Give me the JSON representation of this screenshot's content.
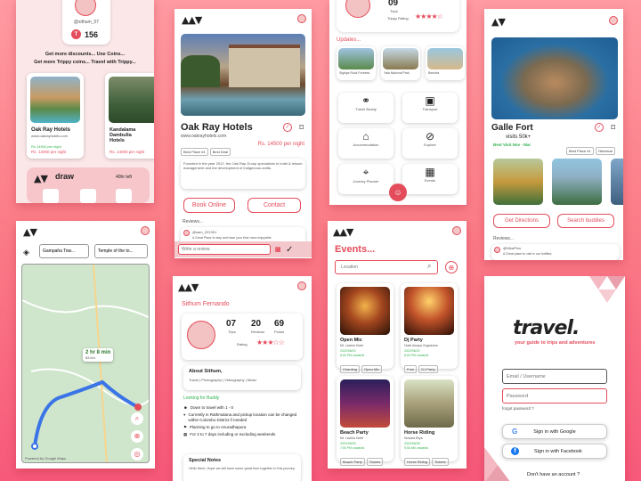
{
  "s1": {
    "username": "@sithum_07",
    "coins": "156",
    "coin_letter": "T",
    "promo_line1": "Get more discounts... Use",
    "promo_coins": "Coins...",
    "promo_line2": "Get more Trippy coins... Travel with Trippy...",
    "hotel1": {
      "name": "Oak Ray Hotels",
      "url": "www.oakrayhotels.com",
      "price": "Rs. 12000 per night",
      "old": "Rs 14500 per night"
    },
    "hotel2": {
      "name": "Kandalama Dambulla Hotels",
      "price": "Rs. 14000 per night"
    },
    "draw_label": "draw",
    "draw_left": "40hr left"
  },
  "s2": {
    "title": "Oak Ray Hotels",
    "url": "www.oakrayhotels.com",
    "tags": [
      "Best Place #1",
      "Best Deal"
    ],
    "price": "Rs. 14500 per night",
    "desc": "Founded in the year 2012, the Oak Ray Group specializes in hotel & leisure management and the development of Indigenous crafts.",
    "book": "Book Online",
    "contact": "Contact",
    "reviews": "Reviews...",
    "reviewer": "@sam_201301",
    "review_text": "A Great Place to stay and have your time more enjoyable.",
    "write_placeholder": "Write a review"
  },
  "s3": {
    "trips": "09",
    "trips_label": "Trips",
    "rating_label": "Trippy Rating",
    "stars": "★★★★☆",
    "updates": "Updates...",
    "update_cards": [
      "Sigiriya Rock Fortress",
      "Yala National Park",
      "Bentota"
    ],
    "menu": [
      "Travel Buddy",
      "Transport",
      "Accommodation",
      "Explore",
      "Journey Planner",
      "Events"
    ]
  },
  "s4": {
    "title": "Galle Fort",
    "visits": "visits 50k+",
    "best_visit": "Best Visit Nov - Mar",
    "tags": [
      "Best Place #1",
      "Historical"
    ],
    "directions": "Get Directions",
    "buddies": "Search buddies",
    "reviews": "Reviews...",
    "reviewer": "@NikaPino",
    "review_text": "A Great place to visit in our fortified."
  },
  "s5": {
    "from": "Gampaha Tow...",
    "to": "Temple of the to...",
    "route": "2 hr 8 min",
    "route_sub": "83 km",
    "credit": "Powered by Google Maps"
  },
  "s6": {
    "name": "Sithum Fernando",
    "trips": "07",
    "trips_label": "Trips",
    "reviews": "20",
    "reviews_label": "Reviews",
    "points": "69",
    "points_label": "Points",
    "rating": "Rating",
    "stars": "★★★☆☆",
    "about_title": "About Sithum,",
    "about_text": "Travel | Photography | Videography | Music",
    "looking": "Looking for Buddy",
    "bullets": [
      "Down to travel with 1 - 0",
      "Currently in Rathmalana and pickup location can be changed within Colombo District if needed",
      "Planning to go to Anuradhapura",
      "For 2 to 7 days including or excluding weekends"
    ],
    "notes_title": "Special Notes",
    "notes_text": "Hello there, Hope we will have some great time together in this journey."
  },
  "s7": {
    "title": "Events...",
    "location_placeholder": "Location",
    "events": [
      {
        "name": "Open Mic",
        "sub": "Mt. Lavinia Hotel",
        "date": "2022/06/20",
        "time": "6:00 PM onwards",
        "tags": [
          "Chanting",
          "Open Mic"
        ]
      },
      {
        "name": "Dj Party",
        "sub": "Hotel Amaya Organizers",
        "date": "2022/06/22",
        "time": "8:00 PM onwards",
        "tags": [
          "Free",
          "DJ Party"
        ]
      },
      {
        "name": "Beach Party",
        "sub": "Mt. Lavinia Hotel",
        "date": "2022/06/25",
        "time": "7:00 PM onwards",
        "tags": [
          "Beach Party",
          "Tickets"
        ]
      },
      {
        "name": "Horse Riding",
        "sub": "Nuwara Eliya",
        "date": "2022/06/28",
        "time": "9:00 AM onwards",
        "tags": [
          "Horse Riding",
          "Tickets"
        ]
      }
    ]
  },
  "s8": {
    "logo": "travel.",
    "tagline": "your guide to trips and adventures",
    "email_placeholder": "Email / Username",
    "password_placeholder": "Password",
    "forgot": "forgot password ?",
    "google": "Sign in with Google",
    "facebook": "Sign in with Facebook",
    "no_account": "Don't have an account ?"
  },
  "colors": {
    "accent": "#e44c5b",
    "bg": "#f7597a"
  }
}
